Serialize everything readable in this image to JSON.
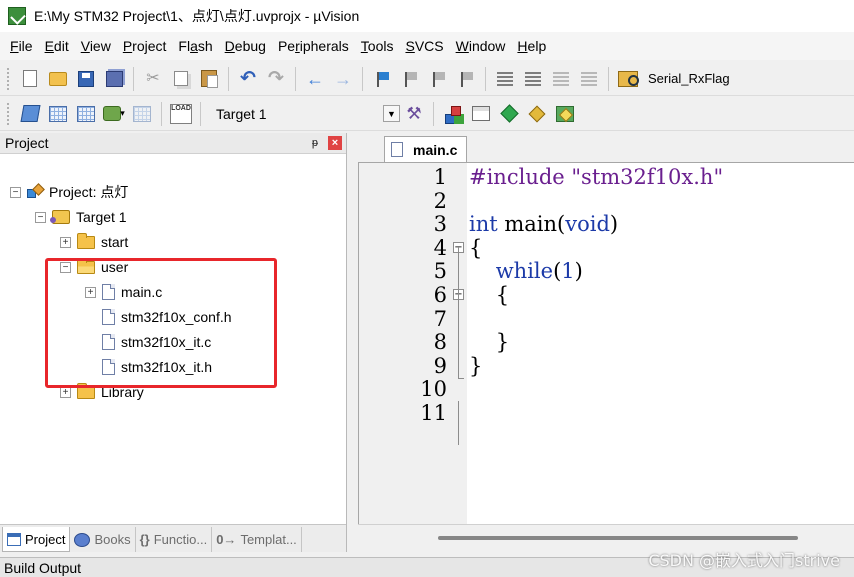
{
  "window": {
    "title": "E:\\My STM32 Project\\1、点灯\\点灯.uvprojx - µVision"
  },
  "menu": [
    {
      "accel": "F",
      "rest": "ile"
    },
    {
      "accel": "E",
      "rest": "dit"
    },
    {
      "accel": "V",
      "rest": "iew"
    },
    {
      "accel": "P",
      "rest": "roject"
    },
    {
      "accel": "",
      "prefix": "Fl",
      "accel2": "a",
      "rest": "sh"
    },
    {
      "accel": "D",
      "rest": "ebug"
    },
    {
      "accel": "",
      "prefix": "Pe",
      "accel2": "r",
      "rest": "ipherals"
    },
    {
      "accel": "T",
      "rest": "ools"
    },
    {
      "accel": "S",
      "rest": "VCS"
    },
    {
      "accel": "W",
      "rest": "indow"
    },
    {
      "accel": "H",
      "rest": "elp"
    }
  ],
  "toolbar": {
    "find_text": "Serial_RxFlag",
    "target": "Target 1",
    "load_label": "LOAD"
  },
  "project_panel": {
    "title": "Project",
    "pin": "ᵽ",
    "close": "×",
    "tree": [
      {
        "label": "Project: 点灯",
        "expander": "−"
      },
      {
        "label": "Target 1",
        "expander": "−"
      },
      {
        "label": "start",
        "expander": "+"
      },
      {
        "label": "user",
        "expander": "−"
      },
      {
        "label": "main.c",
        "expander": "+"
      },
      {
        "label": "stm32f10x_conf.h",
        "expander": ""
      },
      {
        "label": "stm32f10x_it.c",
        "expander": ""
      },
      {
        "label": "stm32f10x_it.h",
        "expander": ""
      },
      {
        "label": "Library",
        "expander": "+"
      }
    ],
    "tabs": [
      {
        "label": "Project"
      },
      {
        "label": "Books"
      },
      {
        "icon_text": "{}",
        "label": "Functio..."
      },
      {
        "icon_text": "0→",
        "label": "Templat..."
      }
    ]
  },
  "editor": {
    "tab": "main.c",
    "lines": [
      {
        "n": "1",
        "tokens": [
          {
            "t": "#include ",
            "c": "kw-pp"
          },
          {
            "t": "\"stm32f10x.h\"",
            "c": "str"
          }
        ]
      },
      {
        "n": "2",
        "tokens": []
      },
      {
        "n": "3",
        "tokens": [
          {
            "t": "int",
            "c": "kw"
          },
          {
            "t": " main(",
            "c": "plain"
          },
          {
            "t": "void",
            "c": "kw"
          },
          {
            "t": ")",
            "c": "plain"
          }
        ]
      },
      {
        "n": "4",
        "tokens": [
          {
            "t": "{",
            "c": "plain"
          }
        ],
        "fold": "−"
      },
      {
        "n": "5",
        "tokens": [
          {
            "t": "    ",
            "c": "plain"
          },
          {
            "t": "while",
            "c": "kw"
          },
          {
            "t": "(",
            "c": "plain"
          },
          {
            "t": "1",
            "c": "num"
          },
          {
            "t": ")",
            "c": "plain"
          }
        ]
      },
      {
        "n": "6",
        "tokens": [
          {
            "t": "    {",
            "c": "plain"
          }
        ],
        "fold": "−"
      },
      {
        "n": "7",
        "tokens": []
      },
      {
        "n": "8",
        "tokens": [
          {
            "t": "    }",
            "c": "plain"
          }
        ]
      },
      {
        "n": "9",
        "tokens": [
          {
            "t": "}",
            "c": "plain"
          }
        ]
      },
      {
        "n": "10",
        "tokens": []
      },
      {
        "n": "11",
        "tokens": []
      }
    ]
  },
  "build_output": {
    "label": "Build Output"
  },
  "watermark": "CSDN @嵌入式入门strive"
}
